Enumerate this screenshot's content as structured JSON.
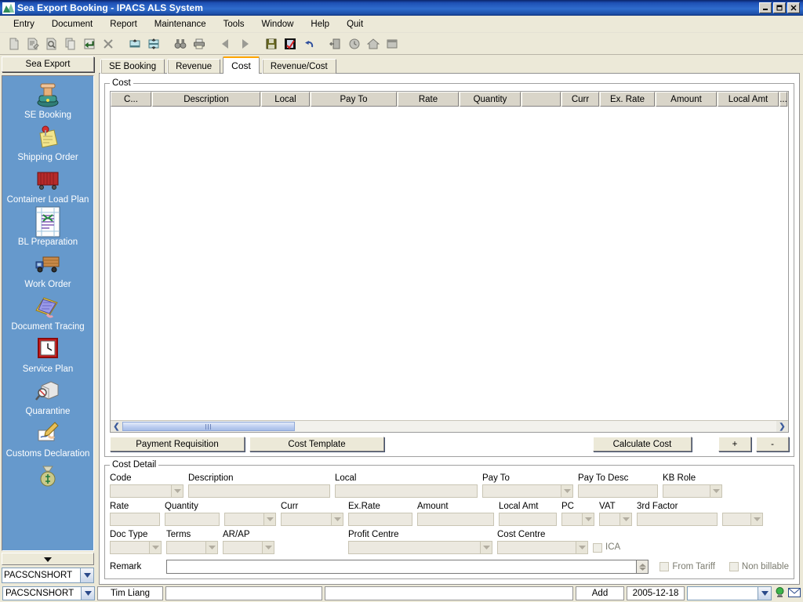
{
  "window": {
    "title": "Sea Export Booking - IPACS ALS System",
    "app_icon": "chart-mountain-icon",
    "minimize": "_",
    "maximize": "❐",
    "close": "✕"
  },
  "menubar": {
    "items": [
      {
        "label": "Entry"
      },
      {
        "label": "Document"
      },
      {
        "label": "Report"
      },
      {
        "label": "Maintenance"
      },
      {
        "label": "Tools"
      },
      {
        "label": "Window"
      },
      {
        "label": "Help"
      },
      {
        "label": "Quit"
      }
    ]
  },
  "toolbar": {
    "items": [
      {
        "name": "new-document-icon"
      },
      {
        "name": "edit-document-icon"
      },
      {
        "name": "preview-document-icon"
      },
      {
        "name": "copy-icon"
      },
      {
        "name": "save-return-icon"
      },
      {
        "name": "delete-icon"
      },
      {
        "name": "expand-row-icon"
      },
      {
        "name": "collapse-row-icon"
      },
      {
        "name": "find-binoculars-icon"
      },
      {
        "name": "print-icon"
      },
      {
        "name": "previous-icon"
      },
      {
        "name": "next-icon"
      },
      {
        "name": "save-floppy-icon"
      },
      {
        "name": "approve-check-icon"
      },
      {
        "name": "undo-icon"
      },
      {
        "name": "exit-door-icon"
      },
      {
        "name": "clock-icon"
      },
      {
        "name": "home-icon"
      },
      {
        "name": "window-icon"
      }
    ]
  },
  "sidebar": {
    "header": "Sea Export",
    "items": [
      {
        "label": "SE Booking",
        "icon": "telephone-icon"
      },
      {
        "label": "Shipping Order",
        "icon": "pinned-note-icon"
      },
      {
        "label": "Container Load Plan",
        "icon": "container-icon"
      },
      {
        "label": "BL Preparation",
        "icon": "document-money-icon"
      },
      {
        "label": "Work Order",
        "icon": "truck-icon"
      },
      {
        "label": "Document Tracing",
        "icon": "folder-hand-icon"
      },
      {
        "label": "Service Plan",
        "icon": "clock-icon"
      },
      {
        "label": "Quarantine",
        "icon": "box-magnifier-icon"
      },
      {
        "label": "Customs Declaration",
        "icon": "signing-hand-icon"
      },
      {
        "label": "",
        "icon": "money-bag-icon"
      }
    ],
    "scroll_down": "▼",
    "company_code": "PACSCNSHORT"
  },
  "tabs": [
    {
      "label": "SE Booking",
      "active": false
    },
    {
      "label": "Revenue",
      "active": false
    },
    {
      "label": "Cost",
      "active": true
    },
    {
      "label": "Revenue/Cost",
      "active": false
    }
  ],
  "cost_panel": {
    "legend": "Cost",
    "columns": [
      {
        "label": "C...",
        "width": 52
      },
      {
        "label": "Description",
        "width": 138
      },
      {
        "label": "Local",
        "width": 62
      },
      {
        "label": "Pay To",
        "width": 110
      },
      {
        "label": "Rate",
        "width": 78
      },
      {
        "label": "Quantity",
        "width": 78
      },
      {
        "label": "",
        "width": 50
      },
      {
        "label": "Curr",
        "width": 48
      },
      {
        "label": "Ex. Rate",
        "width": 70
      },
      {
        "label": "Amount",
        "width": 78
      },
      {
        "label": "Local Amt",
        "width": 78
      },
      {
        "label": "...",
        "width": 26
      }
    ],
    "rows": [],
    "scroll_left": "❮",
    "scroll_right": "❯",
    "buttons": {
      "payment_requisition": "Payment Requisition",
      "cost_template": "Cost Template",
      "calculate_cost": "Calculate Cost",
      "add": "+",
      "remove": "-"
    }
  },
  "cost_detail": {
    "legend": "Cost Detail",
    "row1": [
      {
        "name": "code",
        "label": "Code",
        "value": "",
        "type": "combo",
        "w": 78
      },
      {
        "name": "description",
        "label": "Description",
        "value": "",
        "type": "text",
        "w": 181
      },
      {
        "name": "local",
        "label": "Local",
        "value": "",
        "type": "text",
        "w": 182
      },
      {
        "name": "pay-to",
        "label": "Pay To",
        "value": "",
        "type": "combo",
        "w": 100
      },
      {
        "name": "pay-to-desc",
        "label": "Pay To Desc",
        "value": "",
        "type": "text",
        "w": 102
      },
      {
        "name": "kb-role",
        "label": "KB Role",
        "value": "",
        "type": "combo",
        "w": 76
      }
    ],
    "row2": [
      {
        "name": "rate",
        "label": "Rate",
        "value": "",
        "type": "text",
        "w": 64
      },
      {
        "name": "quantity",
        "label": "Quantity",
        "value": "",
        "type": "text",
        "w": 70
      },
      {
        "name": "quantity-unit",
        "label": "",
        "value": "",
        "type": "combo",
        "w": 66
      },
      {
        "name": "curr",
        "label": "Curr",
        "value": "",
        "type": "combo",
        "w": 80
      },
      {
        "name": "ex-rate",
        "label": "Ex.Rate",
        "value": "",
        "type": "text",
        "w": 82
      },
      {
        "name": "amount",
        "label": "Amount",
        "value": "",
        "type": "text",
        "w": 98
      },
      {
        "name": "local-amt",
        "label": "Local Amt",
        "value": "",
        "type": "text",
        "w": 74
      },
      {
        "name": "pc",
        "label": "PC",
        "value": "",
        "type": "combo",
        "w": 52
      },
      {
        "name": "vat",
        "label": "VAT",
        "value": "",
        "type": "combo",
        "w": 52
      },
      {
        "name": "third-factor",
        "label": "3rd Factor",
        "value": "",
        "type": "text",
        "w": 103
      },
      {
        "name": "third-factor-unit",
        "label": "",
        "value": "",
        "type": "combo",
        "w": 52
      }
    ],
    "row3": [
      {
        "name": "doc-type",
        "label": "Doc Type",
        "value": "",
        "type": "combo",
        "w": 66
      },
      {
        "name": "terms",
        "label": "Terms",
        "value": "",
        "type": "combo",
        "w": 66
      },
      {
        "name": "ar-ap",
        "label": "AR/AP",
        "value": "",
        "type": "combo",
        "w": 66
      },
      {
        "name": "profit-centre",
        "label": "Profit Centre",
        "value": "",
        "type": "combo",
        "w": 184
      },
      {
        "name": "cost-centre",
        "label": "Cost Centre",
        "value": "",
        "type": "combo",
        "w": 116
      }
    ],
    "ica_checkbox": {
      "label": "ICA",
      "checked": false
    },
    "remark": {
      "label": "Remark",
      "value": ""
    },
    "from_tariff": {
      "label": "From Tariff",
      "checked": false
    },
    "non_billable": {
      "label": "Non billable",
      "checked": false
    }
  },
  "statusbar": {
    "company": "PACSCNSHORT",
    "user": "Tim Liang",
    "message": "",
    "extra": "",
    "mode": "Add",
    "date": "2005-12-18",
    "selector": "",
    "icons": [
      {
        "name": "connection-status-icon"
      },
      {
        "name": "mail-icon"
      }
    ]
  },
  "colors": {
    "accent_tab": "#ffa500",
    "titlebar": "#1e50b4",
    "sidebar_bg": "#6699cc",
    "face": "#ece9d8"
  }
}
